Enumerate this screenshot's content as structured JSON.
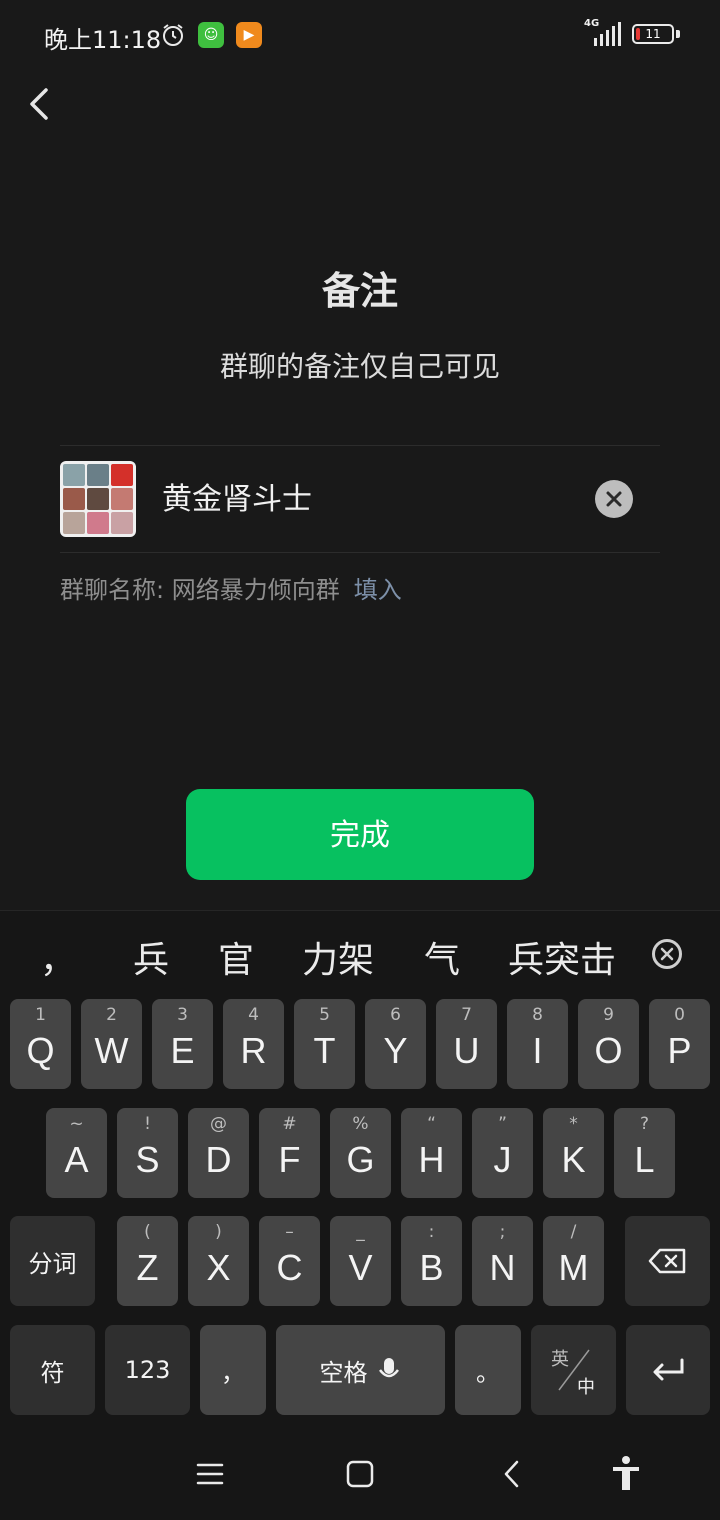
{
  "status_bar": {
    "time": "晚上11:18",
    "network": "4G",
    "battery": "11",
    "icons": [
      "alarm-icon",
      "app-notification-icon",
      "video-app-icon",
      "signal-icon",
      "battery-icon"
    ]
  },
  "header": {
    "back_icon": "back-chevron-icon"
  },
  "main": {
    "title": "备注",
    "subtitle": "群聊的备注仅自己可见",
    "remark_value": "黄金肾斗士",
    "group_name_label": "群聊名称: 网络暴力倾向群",
    "fill_link": "填入",
    "done_label": "完成"
  },
  "keyboard": {
    "candidates": [
      "，",
      "兵",
      "官",
      "力架",
      "气",
      "兵突击"
    ],
    "row1": [
      {
        "hint": "1",
        "key": "Q"
      },
      {
        "hint": "2",
        "key": "W"
      },
      {
        "hint": "3",
        "key": "E"
      },
      {
        "hint": "4",
        "key": "R"
      },
      {
        "hint": "5",
        "key": "T"
      },
      {
        "hint": "6",
        "key": "Y"
      },
      {
        "hint": "7",
        "key": "U"
      },
      {
        "hint": "8",
        "key": "I"
      },
      {
        "hint": "9",
        "key": "O"
      },
      {
        "hint": "0",
        "key": "P"
      }
    ],
    "row2": [
      {
        "hint": "~",
        "key": "A"
      },
      {
        "hint": "!",
        "key": "S"
      },
      {
        "hint": "@",
        "key": "D"
      },
      {
        "hint": "#",
        "key": "F"
      },
      {
        "hint": "%",
        "key": "G"
      },
      {
        "hint": "“",
        "key": "H"
      },
      {
        "hint": "”",
        "key": "J"
      },
      {
        "hint": "*",
        "key": "K"
      },
      {
        "hint": "?",
        "key": "L"
      }
    ],
    "row3": [
      {
        "hint": "(",
        "key": "Z"
      },
      {
        "hint": ")",
        "key": "X"
      },
      {
        "hint": "–",
        "key": "C"
      },
      {
        "hint": "_",
        "key": "V"
      },
      {
        "hint": ":",
        "key": "B"
      },
      {
        "hint": ";",
        "key": "N"
      },
      {
        "hint": "/",
        "key": "M"
      }
    ],
    "split_label": "分词",
    "symbol_label": "符",
    "num_label": "123",
    "comma_label": "，",
    "space_label": "空格",
    "period_label": "。",
    "lang_top": "英",
    "lang_bottom": "中"
  },
  "nav_bar": {
    "icons": [
      "menu-icon",
      "home-icon",
      "back-icon",
      "accessibility-icon"
    ]
  },
  "colors": {
    "accent": "#07c160",
    "link": "#7d90a9",
    "background": "#191919"
  }
}
